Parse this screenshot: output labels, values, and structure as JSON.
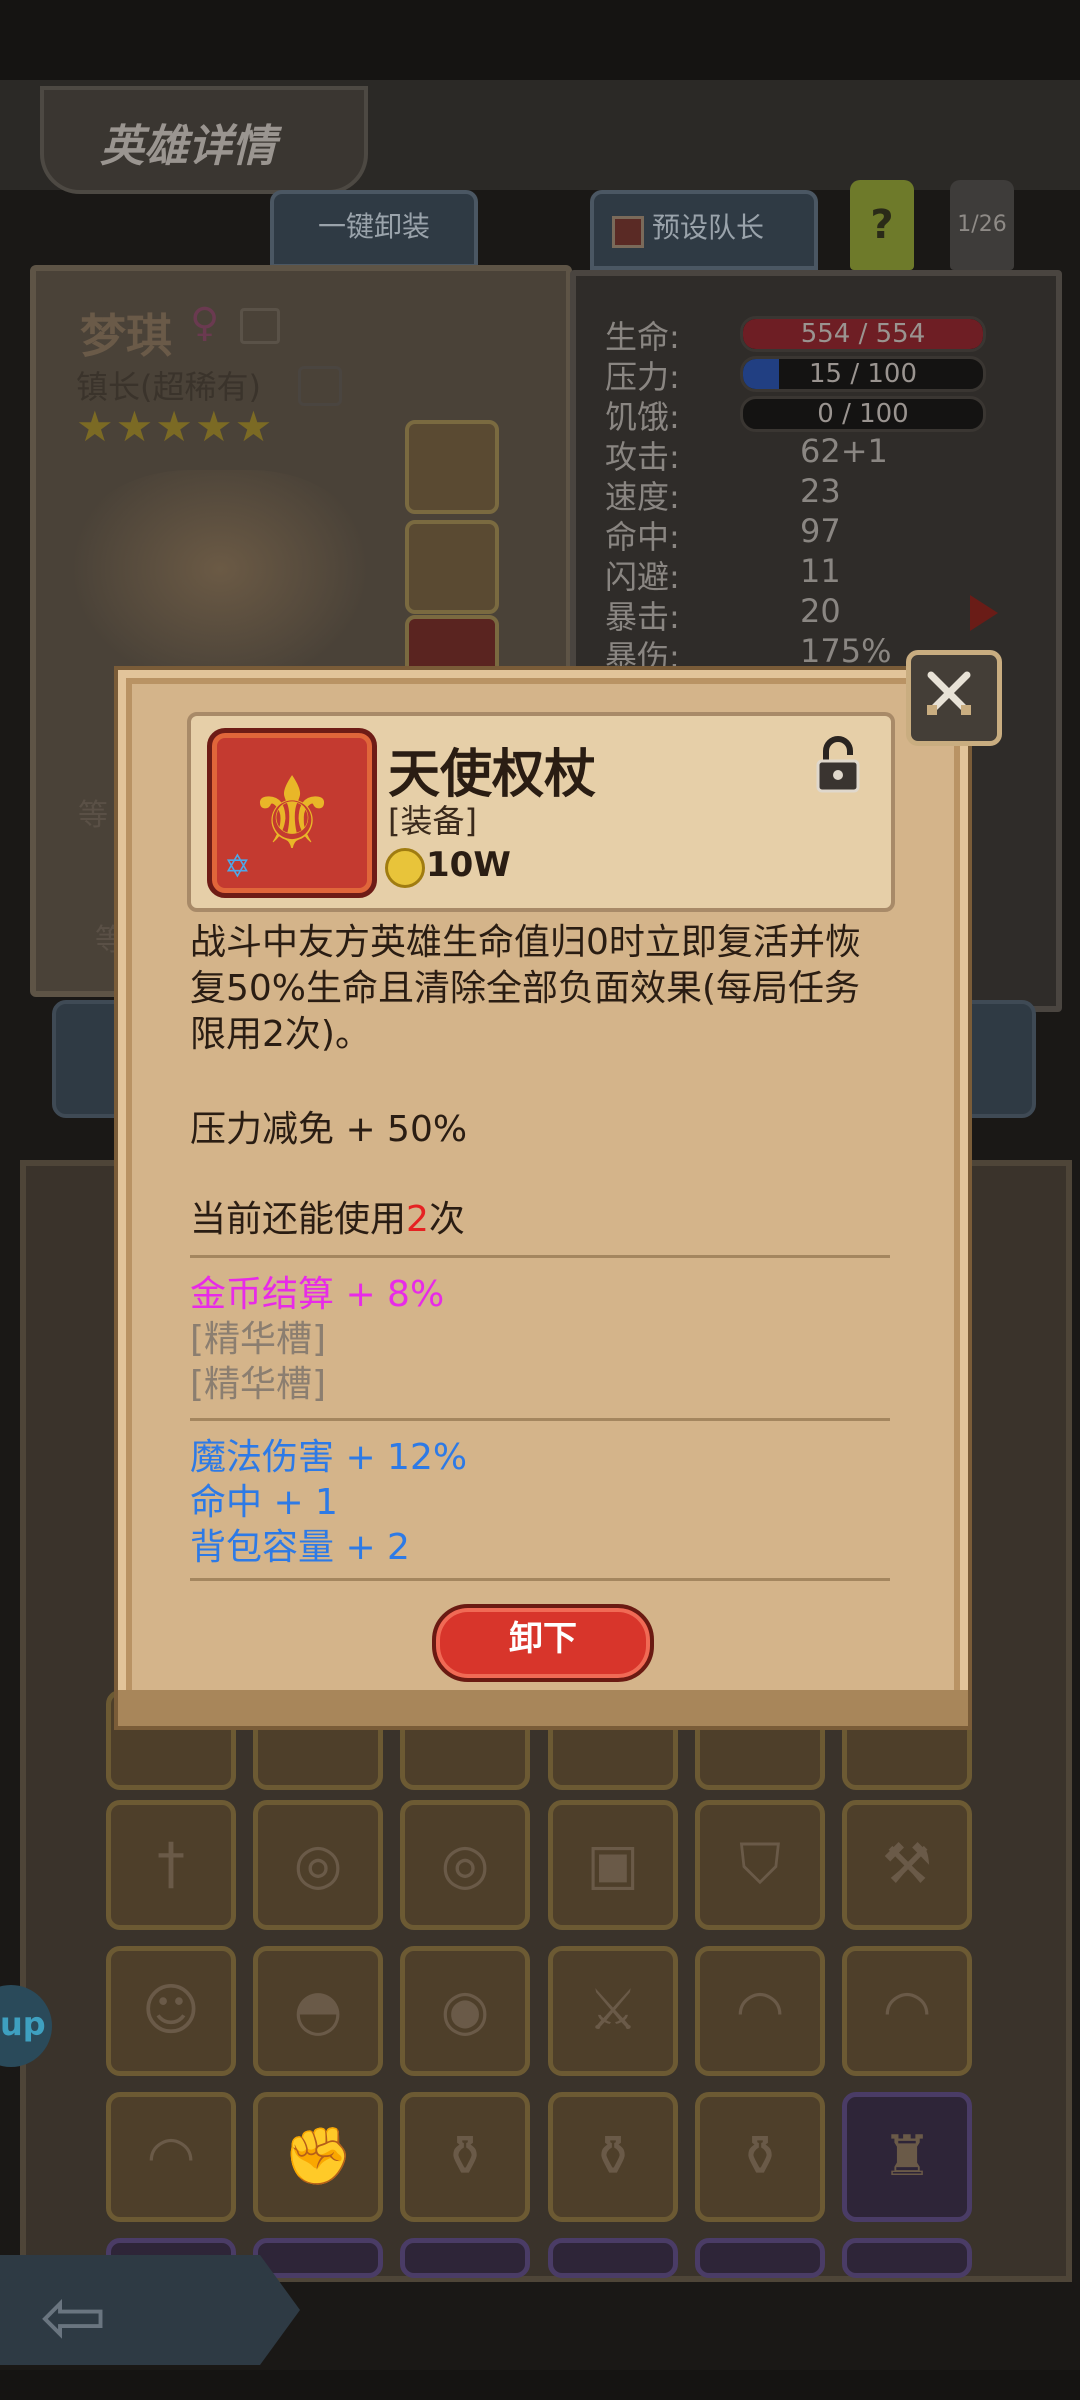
{
  "screen": {
    "title": "英雄详情",
    "unequip_all": "一键卸装",
    "preset_captain": "预设队长",
    "help": "?",
    "page_indicator": "1/26"
  },
  "hero": {
    "name": "梦琪",
    "gender_icon": "female-icon",
    "rank": "镇长(超稀有)",
    "stars": "★★★★★"
  },
  "stats": [
    {
      "label": "生命:",
      "value": "554 / 554",
      "bar": true,
      "fill": 1.0,
      "color": "#6e1e24"
    },
    {
      "label": "压力:",
      "value": "15 / 100",
      "bar": true,
      "fill": 0.15,
      "color": "#213f82"
    },
    {
      "label": "饥饿:",
      "value": "0 / 100",
      "bar": true,
      "fill": 0.0,
      "color": "#3a3632"
    },
    {
      "label": "攻击:",
      "value": "62+1"
    },
    {
      "label": "速度:",
      "value": "23"
    },
    {
      "label": "命中:",
      "value": "97"
    },
    {
      "label": "闪避:",
      "value": "11"
    },
    {
      "label": "暴击:",
      "value": "20"
    },
    {
      "label": "暴伤:",
      "value": "175%"
    }
  ],
  "side_labels": {
    "left_partial_1": "等",
    "left_partial_2": "等",
    "up_bubble": "up"
  },
  "item": {
    "name": "天使权杖",
    "type": "[装备]",
    "price": "10W",
    "description": "战斗中友方英雄生命值归0时立即复活并恢复50%生命且清除全部负面效果(每局任务限用2次)。",
    "stat_line": "压力减免 + 50%",
    "uses_prefix": "当前还能使用",
    "uses_count": "2",
    "uses_suffix": "次",
    "gold_bonus": "金币结算 + 8%",
    "essence_slot_1": "[精华槽]",
    "essence_slot_2": "[精华槽]",
    "attr_1": "魔法伤害 + 12%",
    "attr_2": "命中 + 1",
    "attr_3": "背包容量 + 2",
    "unequip_button": "卸下"
  },
  "colors": {
    "accent_red": "#d8352b",
    "pink": "#e82ae8",
    "blue": "#2d7ae6",
    "gray": "#8b7e70",
    "highlight_red": "#e52222"
  },
  "inventory_icons": [
    [
      "sword-icon",
      "winged-orb-icon",
      "winged-orb-icon",
      "chest-icon",
      "shield-icon",
      "axe-icon"
    ],
    [
      "voodoo-doll-icon",
      "helmet-icon",
      "dragon-ring-icon",
      "crystal-sword-icon",
      "belt-icon",
      "belt-icon"
    ],
    [
      "belt-icon",
      "gauntlet-icon",
      "potion-locked-icon",
      "potion-icon",
      "potion-icon",
      "armor-locked-icon"
    ]
  ]
}
